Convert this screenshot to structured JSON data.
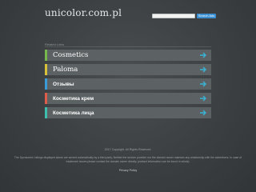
{
  "header": {
    "site_title": "unicolor.com.pl",
    "search_placeholder": "",
    "search_button": "Search Ads"
  },
  "related": {
    "label": "Related Links",
    "links": [
      {
        "label": "Cosmetics",
        "accent": "#77b84d"
      },
      {
        "label": "Paloma",
        "accent": "#d9c13b"
      },
      {
        "label": "Отзывы",
        "accent": "#3b9bd9"
      },
      {
        "label": "Косметика крем",
        "accent": "#e05c4a"
      },
      {
        "label": "Косметика лица",
        "accent": "#3dbfb0"
      }
    ],
    "arrow_icon": "arrow-right-icon",
    "arrow_color": "#3ab4d6"
  },
  "footer": {
    "copyright": "2017 Copyright. All Rights Reserved.",
    "disclaimer": "The Sponsored Listings displayed above are served automatically by a third party. Neither the service provider nor the domain owner maintain any relationship with the advertisers. In case of trademark issues please contact the domain owner directly (contact information can be found in whois).",
    "privacy": "Privacy Policy"
  },
  "colors": {
    "background": "#3e4244",
    "row_background": "#5c6163",
    "search_button": "#3b8fd1"
  }
}
